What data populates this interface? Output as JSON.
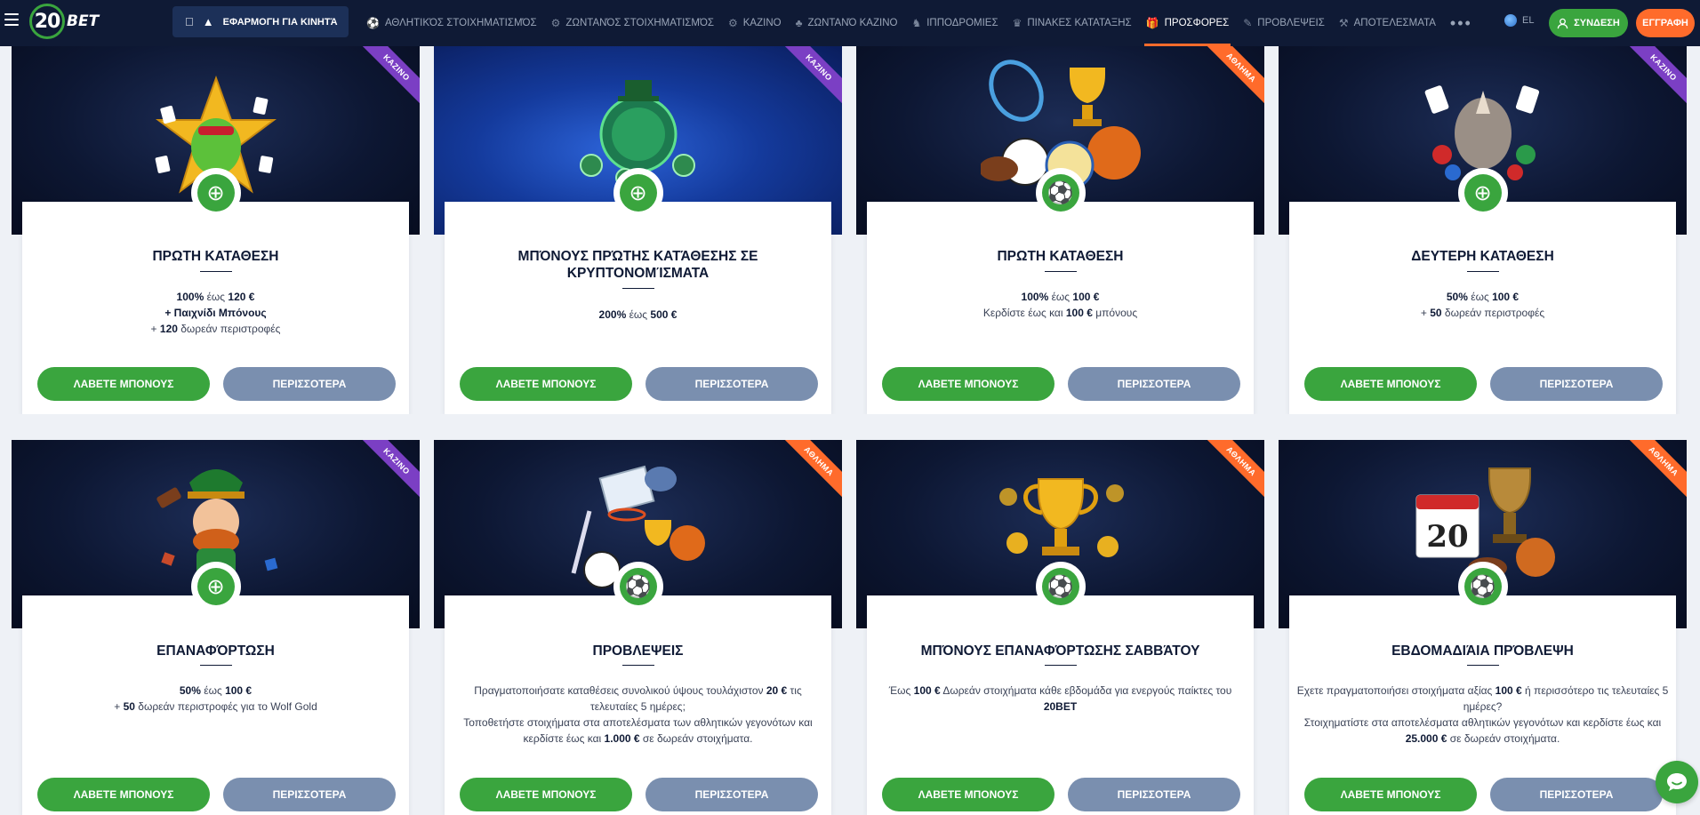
{
  "header": {
    "logo_num": "20",
    "logo_text": "BET",
    "app_label": "ΕΦΑΡΜΟΓΗ ΓΙΑ ΚΙΝΗΤΆ",
    "nav": [
      {
        "label": "ΑΘΛΗΤΙΚΌΣ ΣΤΟΙΧΗΜΑΤΙΣΜΌΣ",
        "icon": "⚽"
      },
      {
        "label": "ΖΩΝΤΑΝΌΣ ΣΤΟΙΧΗΜΑΤΙΣΜΌΣ",
        "icon": "⚙"
      },
      {
        "label": "ΚΑΖΙΝΟ",
        "icon": "⚙"
      },
      {
        "label": "ΖΩΝΤΑΝΌ ΚΑΖΙΝΟ",
        "icon": "♣"
      },
      {
        "label": "ΙΠΠΟΔΡΟΜΙΕΣ",
        "icon": "♞"
      },
      {
        "label": "ΠΙΝΑΚΕΣ ΚΑΤΑΤΑΞΗΣ",
        "icon": "♛"
      },
      {
        "label": "ΠΡΟΣΦΟΡΕΣ",
        "icon": "🎁"
      },
      {
        "label": "ΠΡΟΒΛΕΨΕΙΣ",
        "icon": "✎"
      },
      {
        "label": "ΑΠΟΤΕΛΕΣΜΑΤΑ",
        "icon": "⚒"
      }
    ],
    "more": "•••",
    "lang": "EL",
    "login": "ΣΥΝΔΕΣΗ",
    "register": "ΕΓΓΡΑΦΗ"
  },
  "ribbons": {
    "casino": "ΚΑΖΙΝΟ",
    "sport": "ΑΘΛΗΜΑ"
  },
  "buttons": {
    "get": "ΛΑΒΕΤΕ ΜΠΟΝΟΥΣ",
    "more": "ΠΕΡΙΣΣΟΤΕΡΑ"
  },
  "cards": [
    {
      "title": "ΠΡΩΤΗ ΚΑΤΑΘΕΣΗ"
    },
    {
      "title": "ΜΠΌΝΟΥΣ ΠΡΏΤΗΣ ΚΑΤΆΘΕΣΗΣ ΣΕ ΚΡΥΠΤΟΝΟΜΊΣΜΑΤΑ"
    },
    {
      "title": "ΠΡΩΤΗ ΚΑΤΑΘΕΣΗ"
    },
    {
      "title": "ΔΕΥΤΕΡΗ ΚΑΤΑΘΕΣΗ"
    },
    {
      "title": "ΕΠΑΝΑΦΌΡΤΩΣΗ"
    },
    {
      "title": "ΠΡΟΒΛΕΨΕΙΣ"
    },
    {
      "title": "ΜΠΌΝΟΥΣ ΕΠΑΝΑΦΌΡΤΩΣΗΣ ΣΑΒΒΆΤΟΥ"
    },
    {
      "title": "ΕΒΔΟΜΑΔΙΆΙΑ ΠΡΌΒΛΕΨΗ"
    }
  ],
  "desc": {
    "c1": {
      "a": "100%",
      "b": " έως ",
      "c": "120 €",
      "d": "+ Παιχνίδι Μπόνους",
      "e": "+ ",
      "f": "120",
      "g": " δωρεάν περιστροφές"
    },
    "c2": {
      "a": "200%",
      "b": " έως ",
      "c": "500 €"
    },
    "c3": {
      "a": "100%",
      "b": " έως ",
      "c": "100 €",
      "d": "Κερδίστε έως και ",
      "e": "100 €",
      "f": " μπόνους"
    },
    "c4": {
      "a": "50%",
      "b": " έως ",
      "c": "100 €",
      "d": "+ ",
      "e": "50",
      "f": " δωρεάν περιστροφές"
    },
    "c5": {
      "a": "50%",
      "b": " έως ",
      "c": "100 €",
      "d": "+ ",
      "e": "50",
      "f": " δωρεάν περιστροφές για το Wolf Gold"
    },
    "c6": {
      "a": "Πραγματοποιήσατε καταθέσεις συνολικού ύψους τουλάχιστον ",
      "b": "20 €",
      "c": " τις τελευταίες 5 ημέρες;",
      "d": "Τοποθετήστε στοιχήματα στα αποτελέσματα των αθλητικών γεγονότων και κερδίστε έως και ",
      "e": "1.000 €",
      "f": " σε δωρεάν στοιχήματα."
    },
    "c7": {
      "a": "Έως ",
      "b": "100 €",
      "c": " Δωρεάν στοιχήματα κάθε εβδομάδα για ενεργούς παίκτες του ",
      "d": "20BET"
    },
    "c8": {
      "a": "Εχετε πραγματοποιήσει στοιχήματα αξίας ",
      "b": "100 €",
      "c": " ή περισσότερο τις τελευταίες 5 ημέρες?",
      "d": "Στοιχηματίστε στα αποτελέσματα αθλητικών γεγονότων και κερδίστε έως και ",
      "e": "25.000 €",
      "f": " σε δωρεάν στοιχήματα."
    }
  },
  "art_text": {
    "calendar_num": "20"
  },
  "colors": {
    "brand_green": "#3aa53e",
    "accent_orange": "#ff6b2b",
    "casino_purple": "#7b3fc4",
    "header_navy": "#0f1a35",
    "more_button": "#7a8faf"
  }
}
